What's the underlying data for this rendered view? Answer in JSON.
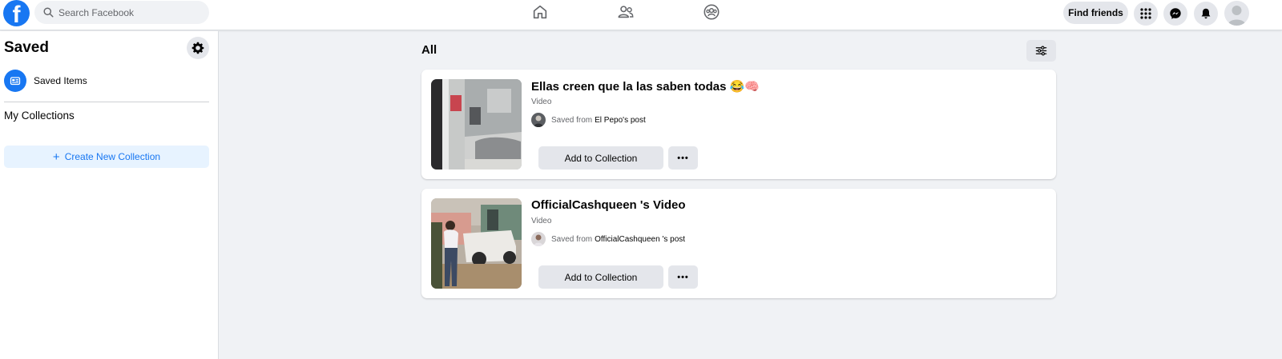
{
  "header": {
    "logo_letter": "f",
    "search_placeholder": "Search Facebook",
    "nav_icons": [
      "home-icon",
      "friends-icon",
      "groups-icon"
    ],
    "find_friends_label": "Find friends",
    "right_icons": [
      "menu-grid-icon",
      "messenger-icon",
      "notifications-bell-icon"
    ],
    "brand_color": "#1877f2"
  },
  "sidebar": {
    "title": "Saved",
    "settings_icon": "gear-icon",
    "saved_items_label": "Saved Items",
    "collections_title": "My Collections",
    "create_collection_label": "Create New Collection",
    "create_collection_icon": "+"
  },
  "main": {
    "section_title": "All",
    "filter_icon": "sliders-icon",
    "items": [
      {
        "title": "Ellas creen que la las saben todas 😂🧠",
        "type": "Video",
        "saved_from_prefix": "Saved from",
        "saved_from_source": "El Pepo's post",
        "add_label": "Add to Collection",
        "more_label": "•••"
      },
      {
        "title": "OfficialCashqueen 's Video",
        "type": "Video",
        "saved_from_prefix": "Saved from",
        "saved_from_source": "OfficialCashqueen 's post",
        "add_label": "Add to Collection",
        "more_label": "•••"
      }
    ]
  }
}
